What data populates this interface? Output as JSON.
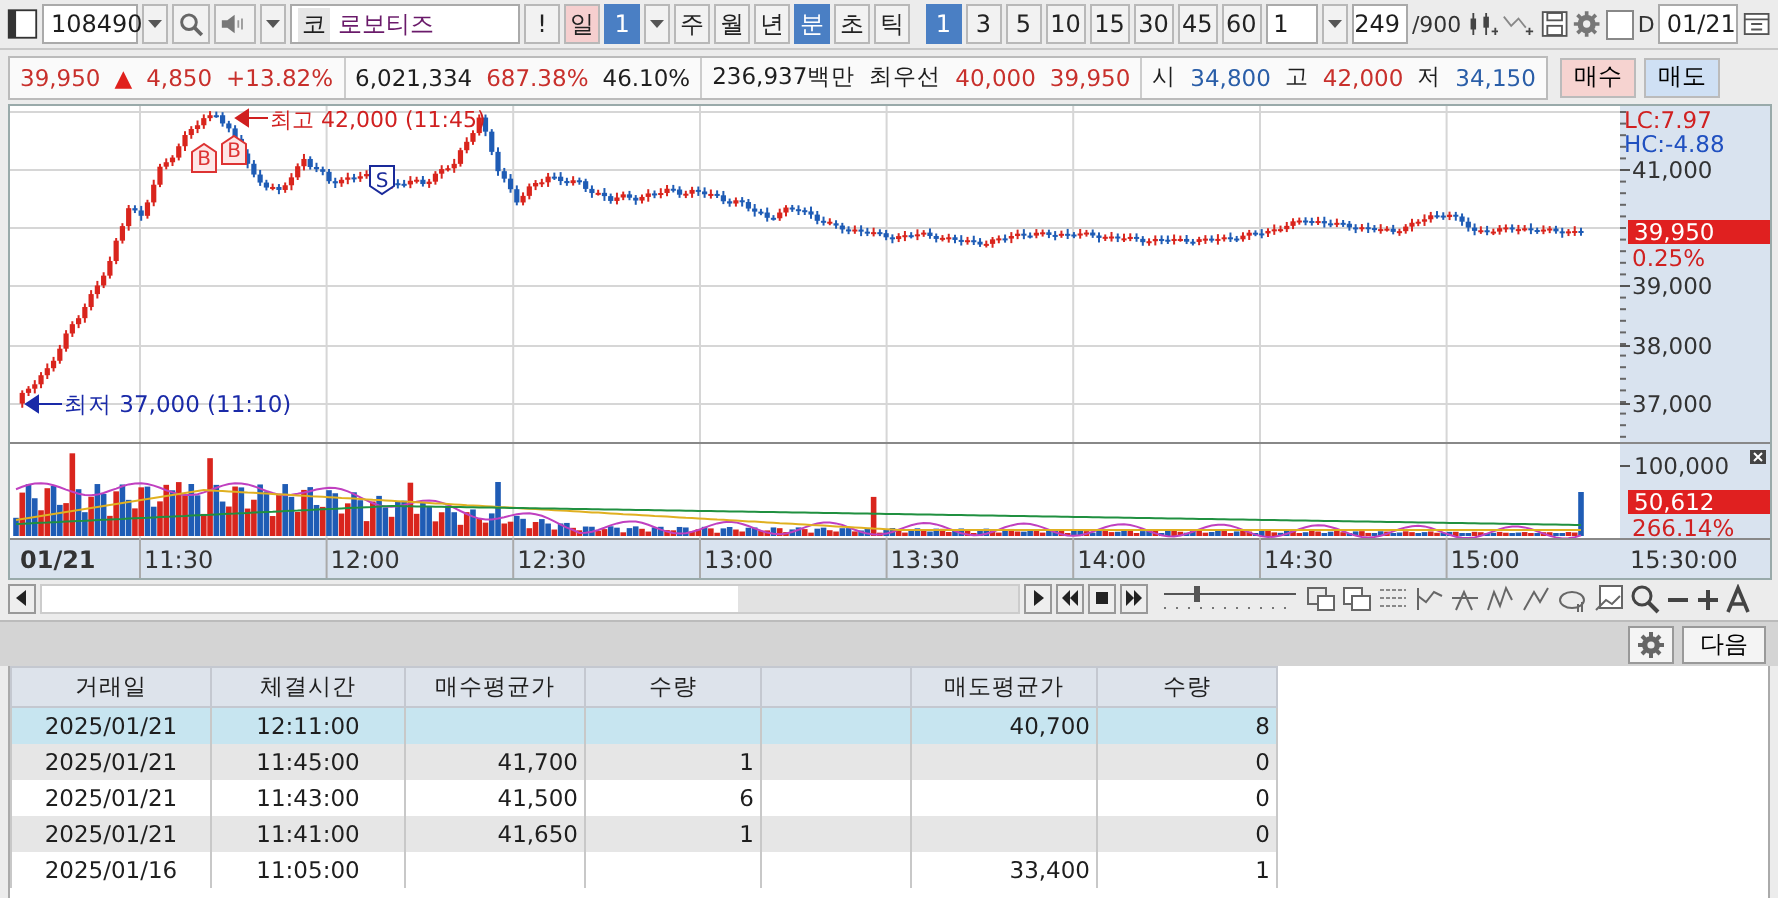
{
  "toolbar": {
    "stock_code": "108490",
    "market": "코",
    "stock_name": "로보티즈",
    "alert": "!",
    "day_period": {
      "label": "일",
      "value": "1"
    },
    "periods": [
      {
        "label": "주",
        "selected": false
      },
      {
        "label": "월",
        "selected": false
      },
      {
        "label": "년",
        "selected": false
      },
      {
        "label": "분",
        "selected": true
      },
      {
        "label": "초",
        "selected": false
      },
      {
        "label": "틱",
        "selected": false
      }
    ],
    "intervals": [
      {
        "label": "1",
        "selected": true
      },
      {
        "label": "3",
        "selected": false
      },
      {
        "label": "5",
        "selected": false
      },
      {
        "label": "10",
        "selected": false
      },
      {
        "label": "15",
        "selected": false
      },
      {
        "label": "30",
        "selected": false
      },
      {
        "label": "45",
        "selected": false
      },
      {
        "label": "60",
        "selected": false
      }
    ],
    "multiplier": "1",
    "count": "249",
    "count_max": "/900",
    "checkbox": {
      "label": "D",
      "checked": false
    },
    "date": "01/21"
  },
  "quote": {
    "segments": [
      [
        {
          "text": "39,950",
          "color": "#c8302c"
        },
        {
          "text": "▲",
          "color": "#e0201c"
        },
        {
          "text": "4,850",
          "color": "#c8302c"
        },
        {
          "text": "+13.82%",
          "color": "#c8302c"
        }
      ],
      [
        {
          "text": "6,021,334",
          "color": "#1e1e1e"
        },
        {
          "text": "687.38%",
          "color": "#c8302c"
        },
        {
          "text": "46.10%",
          "color": "#1e1e1e"
        }
      ],
      [
        {
          "text": "236,937백만",
          "color": "#1e1e1e"
        },
        {
          "text": "최우선",
          "color": "#1e1e1e"
        },
        {
          "text": "40,000",
          "color": "#c8302c"
        },
        {
          "text": "39,950",
          "color": "#c8302c"
        }
      ],
      [
        {
          "text": "시",
          "color": "#1e1e1e"
        },
        {
          "text": "34,800",
          "color": "#2a5ea8"
        },
        {
          "text": "고",
          "color": "#1e1e1e"
        },
        {
          "text": "42,000",
          "color": "#c8302c"
        },
        {
          "text": "저",
          "color": "#1e1e1e"
        },
        {
          "text": "34,150",
          "color": "#2a5ea8"
        }
      ]
    ],
    "buttons": [
      {
        "label": "매수",
        "kind": "buy"
      },
      {
        "label": "매도",
        "kind": "sell"
      }
    ]
  },
  "chart": {
    "high_note": "최고 42,000 (11:45)",
    "low_note": "최저 37,000 (11:10)",
    "markers": [
      {
        "label": "B",
        "kind": "buy"
      },
      {
        "label": "B",
        "kind": "buy"
      },
      {
        "label": "S",
        "kind": "sell"
      }
    ],
    "indicators": [
      {
        "text": "LC:7.97",
        "color": "#d02020"
      },
      {
        "text": "HC:-4.88",
        "color": "#2050c0"
      }
    ],
    "price_ticks": [
      "41,000",
      "39,000",
      "38,000",
      "37,000"
    ],
    "current_price": "39,950",
    "current_change": "0.25%",
    "volume_tick": "100,000",
    "current_volume": "50,612",
    "volume_ratio": "266.14%",
    "time_labels": [
      "01/21",
      "11:30",
      "12:00",
      "12:30",
      "13:00",
      "13:30",
      "14:00",
      "14:30",
      "15:00"
    ],
    "end_time": "15:30:00"
  },
  "zoom_slider": {
    "level": 0.25
  },
  "panel": {
    "next_button": "다음"
  },
  "table": {
    "columns": [
      "거래일",
      "체결시간",
      "매수평균가",
      "수량",
      null,
      "매도평균가",
      "수량"
    ],
    "rows": [
      {
        "selected": true,
        "cells": [
          "2025/01/21",
          "12:11:00",
          null,
          null,
          null,
          "40,700",
          "8"
        ]
      },
      {
        "selected": false,
        "cells": [
          "2025/01/21",
          "11:45:00",
          "41,700",
          "1",
          null,
          null,
          "0"
        ]
      },
      {
        "selected": false,
        "cells": [
          "2025/01/21",
          "11:43:00",
          "41,500",
          "6",
          null,
          null,
          "0"
        ]
      },
      {
        "selected": false,
        "cells": [
          "2025/01/21",
          "11:41:00",
          "41,650",
          "1",
          null,
          null,
          "0"
        ]
      },
      {
        "selected": false,
        "cells": [
          "2025/01/16",
          "11:05:00",
          null,
          null,
          null,
          "33,400",
          "1"
        ]
      }
    ]
  }
}
